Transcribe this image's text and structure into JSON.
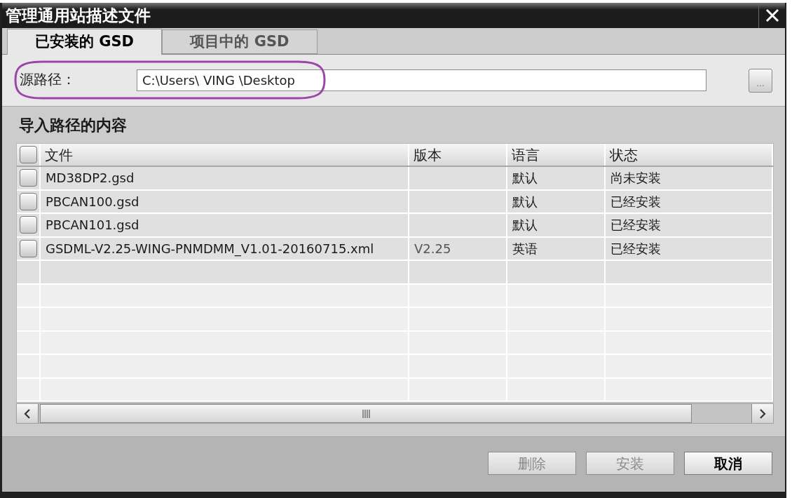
{
  "window": {
    "title": "管理通用站描述文件"
  },
  "tabs": [
    {
      "label": "已安装的 GSD",
      "selected": true
    },
    {
      "label": "项目中的 GSD",
      "selected": false
    }
  ],
  "source_path": {
    "label": "源路径：",
    "value": "C:\\Users\\ VING \\Desktop",
    "browse_button": "...",
    "highlighted": true
  },
  "content_heading": "导入路径的内容",
  "table": {
    "select_all_checked": false,
    "columns": [
      "文件",
      "版本",
      "语言",
      "状态"
    ],
    "rows": [
      {
        "checked": false,
        "file": "MD38DP2.gsd",
        "language": "默认",
        "status": "尚未安装"
      },
      {
        "checked": false,
        "file": "PBCAN100.gsd",
        "language": "默认",
        "status": "已经安装"
      },
      {
        "checked": false,
        "file": "PBCAN101.gsd",
        "language": "默认",
        "status": "已经安装"
      },
      {
        "checked": false,
        "file": "GSDML-V2.25-WING-PNMDMM_V1.01-20160715.xml",
        "version": "V2.25",
        "language": "英语",
        "status": "已经安装"
      }
    ]
  },
  "buttons": [
    {
      "label": "删除",
      "disabled": true
    },
    {
      "label": "安装",
      "disabled": true
    },
    {
      "label": "取消",
      "disabled": false
    }
  ]
}
